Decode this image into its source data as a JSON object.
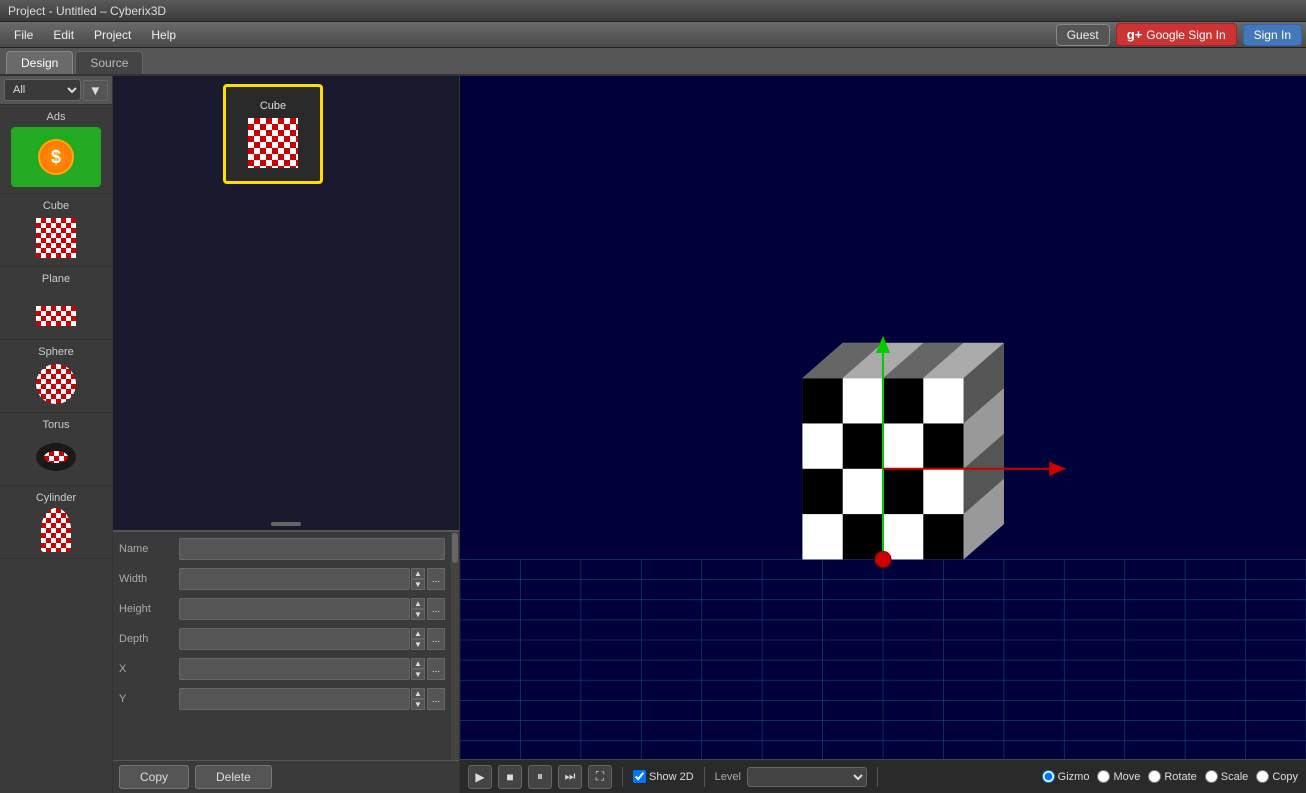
{
  "titleBar": {
    "title": "Project - Untitled – Cyberix3D"
  },
  "menuBar": {
    "items": [
      "File",
      "Edit",
      "Project",
      "Help"
    ],
    "auth": {
      "guest": "Guest",
      "googleSignIn": "Google Sign In",
      "signIn": "Sign In"
    }
  },
  "tabs": [
    {
      "id": "design",
      "label": "Design",
      "active": true
    },
    {
      "id": "source",
      "label": "Source",
      "active": false
    }
  ],
  "library": {
    "filter": "All",
    "items": [
      {
        "id": "ads",
        "label": "Ads",
        "type": "ads"
      },
      {
        "id": "cube",
        "label": "Cube",
        "type": "cube"
      },
      {
        "id": "plane",
        "label": "Plane",
        "type": "plane"
      },
      {
        "id": "sphere",
        "label": "Sphere",
        "type": "sphere"
      },
      {
        "id": "torus",
        "label": "Torus",
        "type": "torus"
      },
      {
        "id": "cylinder",
        "label": "Cylinder",
        "type": "cylinder"
      }
    ]
  },
  "scene": {
    "items": [
      {
        "id": "cube1",
        "label": "Cube",
        "selected": true
      }
    ]
  },
  "properties": {
    "fields": [
      {
        "id": "name",
        "label": "Name",
        "value": ""
      },
      {
        "id": "width",
        "label": "Width",
        "value": ""
      },
      {
        "id": "height",
        "label": "Height",
        "value": ""
      },
      {
        "id": "depth",
        "label": "Depth",
        "value": ""
      },
      {
        "id": "x",
        "label": "X",
        "value": ""
      },
      {
        "id": "y",
        "label": "Y",
        "value": ""
      }
    ]
  },
  "buttons": {
    "copy": "Copy",
    "delete": "Delete"
  },
  "viewport": {
    "toolbar": {
      "show2d": "Show 2D",
      "level": "Level",
      "gizmo": "Gizmo",
      "move": "Move",
      "rotate": "Rotate",
      "scale": "Scale",
      "copy": "Copy"
    }
  }
}
